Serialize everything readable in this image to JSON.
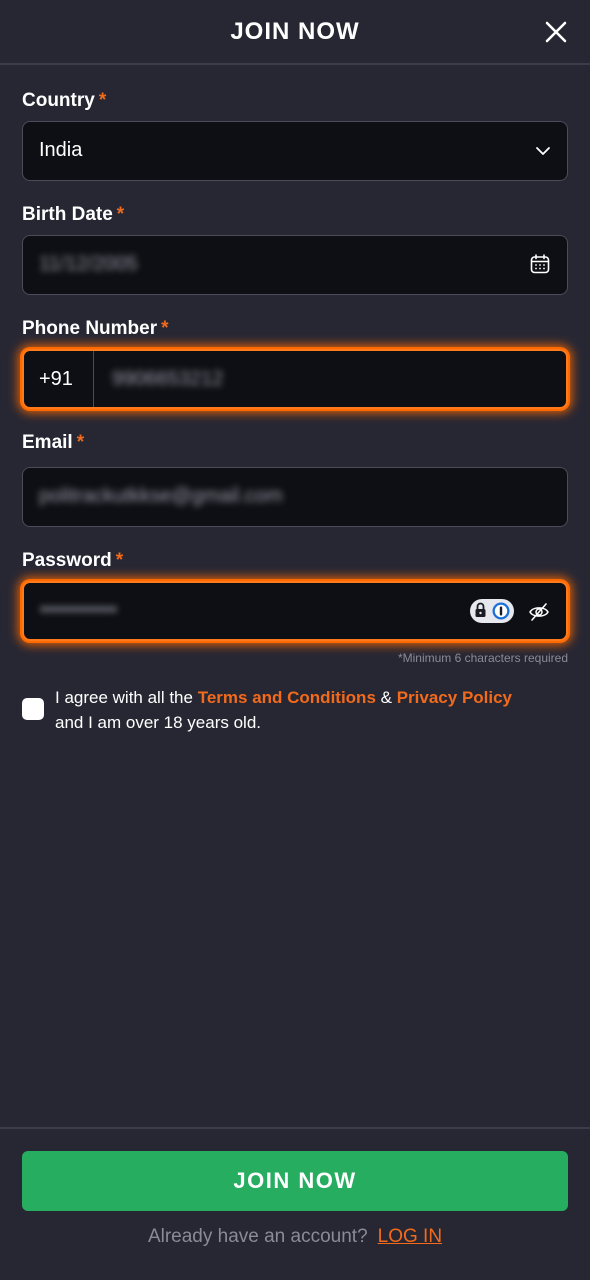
{
  "header": {
    "title": "JOIN NOW"
  },
  "form": {
    "required_mark": "*",
    "country": {
      "label": "Country",
      "value": "India"
    },
    "birth_date": {
      "label": "Birth Date",
      "value": "11/12/2005"
    },
    "phone": {
      "label": "Phone Number",
      "prefix": "+91",
      "value": "9906653212"
    },
    "email": {
      "label": "Email",
      "value": "politrackutkkse@gmail.com"
    },
    "password": {
      "label": "Password",
      "value": "•••••••••••",
      "hint": "*Minimum 6 characters required"
    }
  },
  "agreement": {
    "text_1": "I agree with all the",
    "terms_link": "Terms and Conditions",
    "amp": "&",
    "privacy_link": "Privacy Policy",
    "text_2": "and I am over 18 years old."
  },
  "footer": {
    "join_button": "JOIN NOW",
    "already_text": "Already have an account?",
    "login_link": "LOG IN"
  },
  "colors": {
    "accent": "#f26a1b",
    "primary_button": "#26ad60",
    "background": "#272733",
    "field_bg": "#0e0f14"
  },
  "icons": [
    "close-icon",
    "chevron-down-icon",
    "calendar-icon",
    "password-manager-icon",
    "eye-off-icon"
  ]
}
